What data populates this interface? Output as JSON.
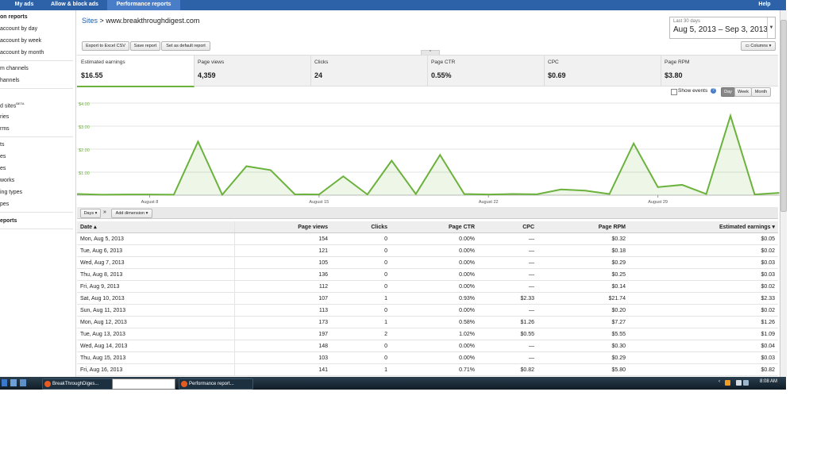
{
  "topnav": {
    "tabs": [
      {
        "label": "My ads"
      },
      {
        "label": "Allow & block ads"
      },
      {
        "label": "Performance reports"
      },
      {
        "label": "Help"
      }
    ]
  },
  "sidebar": {
    "items": [
      {
        "label": "on reports"
      },
      {
        "label": "account by day"
      },
      {
        "label": "account by week"
      },
      {
        "label": "account by month"
      },
      {
        "label": "m channels"
      },
      {
        "label": "hannels"
      },
      {
        "label": "d sites"
      },
      {
        "label": "ries"
      },
      {
        "label": "rms"
      },
      {
        "label": "ts"
      },
      {
        "label": "es"
      },
      {
        "label": "es"
      },
      {
        "label": "works"
      },
      {
        "label": "ing types"
      },
      {
        "label": "pes"
      },
      {
        "label": "eports"
      }
    ],
    "beta_badge": "BETA"
  },
  "header": {
    "breadcrumb_link": "Sites",
    "breadcrumb_sep": ">",
    "site": "www.breakthroughdigest.com",
    "date_small": "Last 30 days",
    "date_range": "Aug 5, 2013 – Sep 3, 2013",
    "export_label": "Export to Excel CSV",
    "save_label": "Save report",
    "default_label": "Set as default report",
    "columns_label": "Columns"
  },
  "metrics": [
    {
      "label": "Estimated earnings",
      "value": "$16.55"
    },
    {
      "label": "Page views",
      "value": "4,359"
    },
    {
      "label": "Clicks",
      "value": "24"
    },
    {
      "label": "Page CTR",
      "value": "0.55%"
    },
    {
      "label": "CPC",
      "value": "$0.69"
    },
    {
      "label": "Page RPM",
      "value": "$3.80"
    }
  ],
  "chart_controls": {
    "show_events": "Show events",
    "day": "Day",
    "week": "Week",
    "month": "Month"
  },
  "chart_data": {
    "type": "area",
    "y_ticks": [
      "$4.00",
      "$3.00",
      "$2.00",
      "$1.00"
    ],
    "x_ticks": [
      "August 8",
      "August 15",
      "August 22",
      "August 29"
    ],
    "ylim": [
      0,
      4
    ],
    "series": [
      {
        "values": [
          0.05,
          0.02,
          0.03,
          0.03,
          0.02,
          2.33,
          0.02,
          1.26,
          1.09,
          0.04,
          0.03,
          0.82,
          0.03,
          1.5,
          0.05,
          1.75,
          0.05,
          0.03,
          0.05,
          0.04,
          0.25,
          0.2,
          0.05,
          2.25,
          0.35,
          0.45,
          0.05,
          3.45,
          0.03,
          0.1
        ]
      }
    ],
    "color": "#6bb23c",
    "grid": true
  },
  "toolbar2": {
    "days": "Days",
    "add_dimension": "Add dimension"
  },
  "table": {
    "headers": [
      "Date",
      "Page views",
      "Clicks",
      "Page CTR",
      "CPC",
      "Page RPM",
      "Estimated earnings"
    ],
    "rows": [
      [
        "Mon, Aug 5, 2013",
        "154",
        "0",
        "0.00%",
        "—",
        "$0.32",
        "$0.05"
      ],
      [
        "Tue, Aug 6, 2013",
        "121",
        "0",
        "0.00%",
        "—",
        "$0.18",
        "$0.02"
      ],
      [
        "Wed, Aug 7, 2013",
        "105",
        "0",
        "0.00%",
        "—",
        "$0.29",
        "$0.03"
      ],
      [
        "Thu, Aug 8, 2013",
        "136",
        "0",
        "0.00%",
        "—",
        "$0.25",
        "$0.03"
      ],
      [
        "Fri, Aug 9, 2013",
        "112",
        "0",
        "0.00%",
        "—",
        "$0.14",
        "$0.02"
      ],
      [
        "Sat, Aug 10, 2013",
        "107",
        "1",
        "0.93%",
        "$2.33",
        "$21.74",
        "$2.33"
      ],
      [
        "Sun, Aug 11, 2013",
        "113",
        "0",
        "0.00%",
        "—",
        "$0.20",
        "$0.02"
      ],
      [
        "Mon, Aug 12, 2013",
        "173",
        "1",
        "0.58%",
        "$1.26",
        "$7.27",
        "$1.26"
      ],
      [
        "Tue, Aug 13, 2013",
        "197",
        "2",
        "1.02%",
        "$0.55",
        "$5.55",
        "$1.09"
      ],
      [
        "Wed, Aug 14, 2013",
        "148",
        "0",
        "0.00%",
        "—",
        "$0.30",
        "$0.04"
      ],
      [
        "Thu, Aug 15, 2013",
        "103",
        "0",
        "0.00%",
        "—",
        "$0.29",
        "$0.03"
      ],
      [
        "Fri, Aug 16, 2013",
        "141",
        "1",
        "0.71%",
        "$0.82",
        "$5.80",
        "$0.82"
      ]
    ]
  },
  "taskbar": {
    "item1": "BreakThroughDiges...",
    "item2": "Performance report...",
    "clock": "8:08 AM"
  },
  "colors": {
    "nav_bg": "#2e62a8",
    "accent_green": "#6bb23c",
    "link_blue": "#1a5fb4"
  }
}
